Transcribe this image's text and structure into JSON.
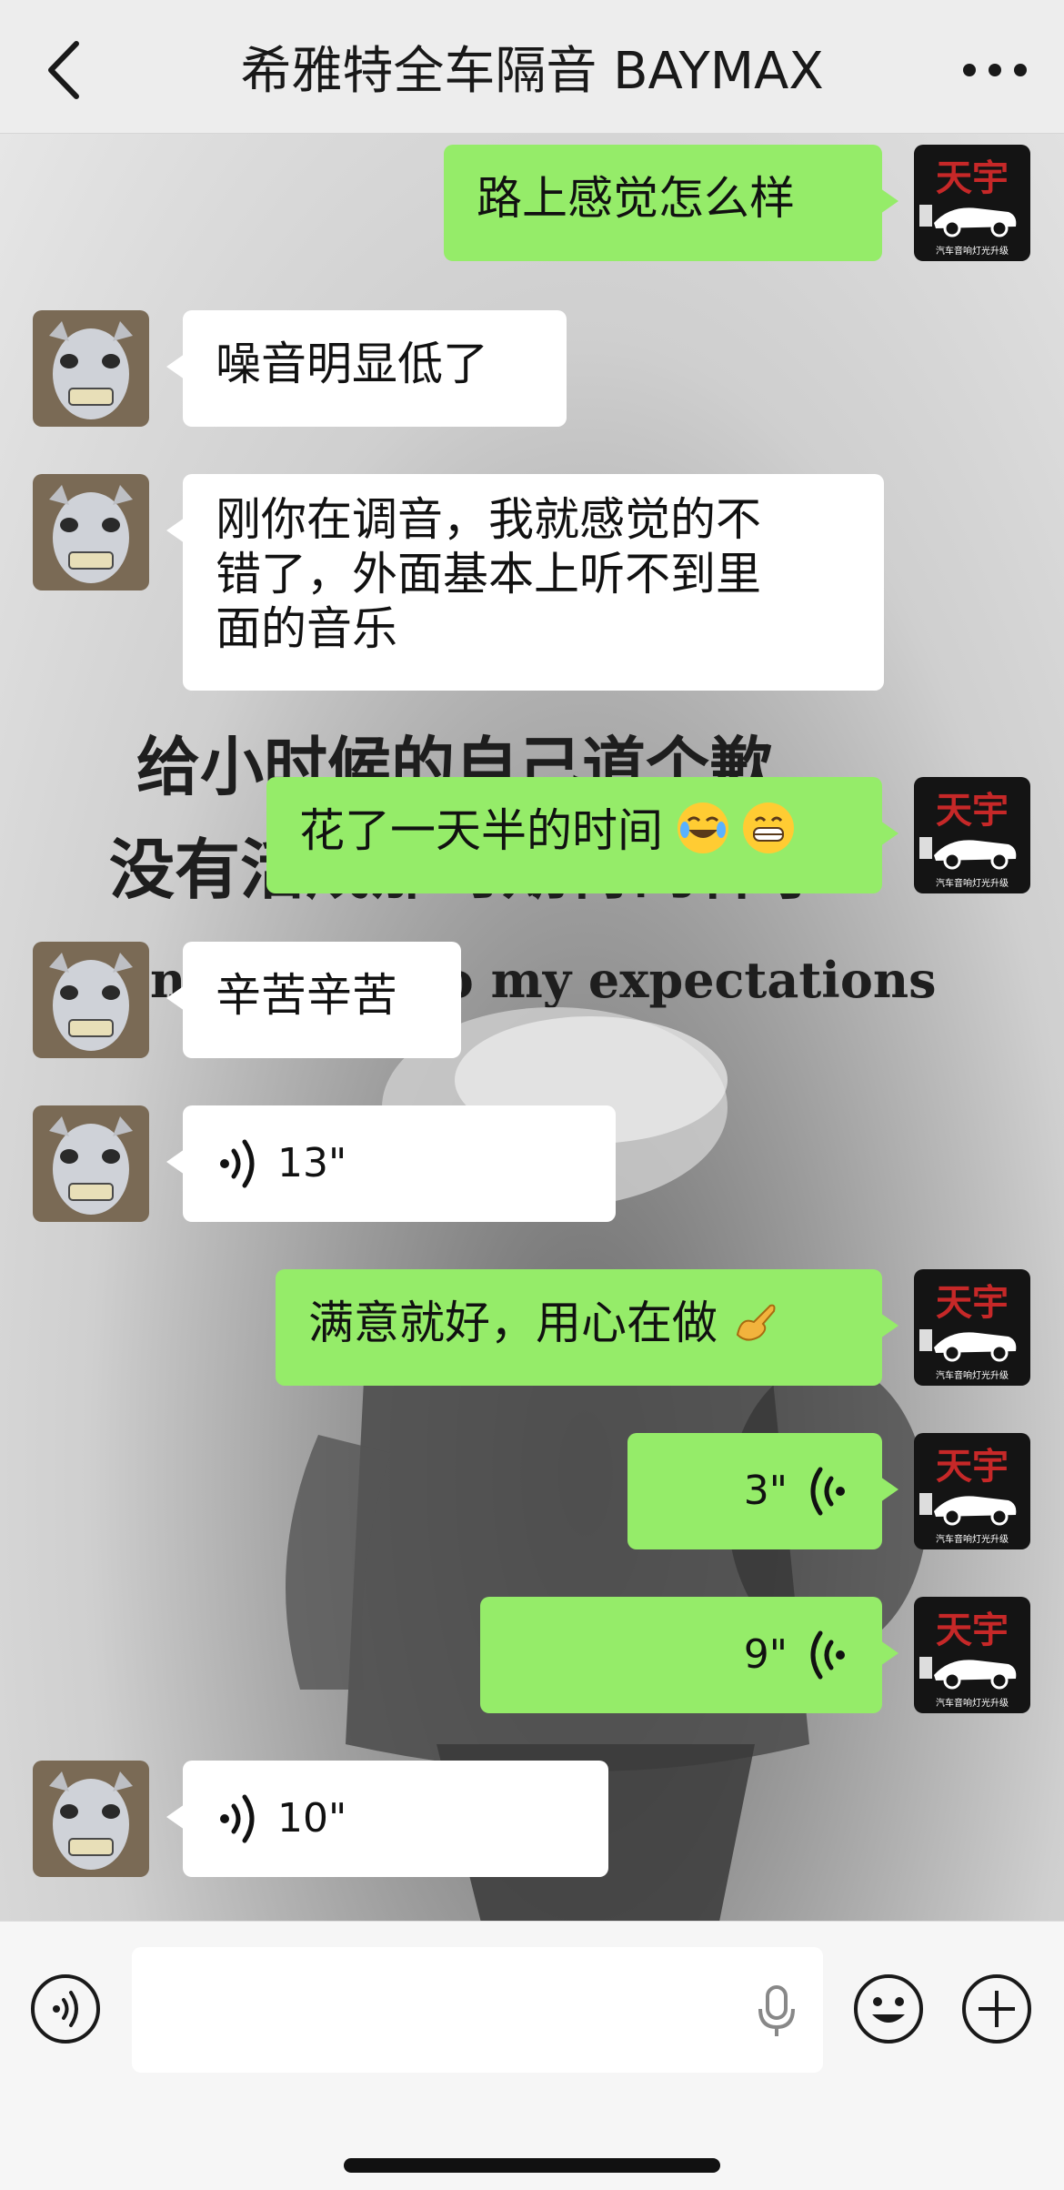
{
  "header": {
    "title": "希雅特全车隔音 BAYMAX"
  },
  "background_text": {
    "line1": "给小时候的自己道个歉",
    "line2": "没有活成那时期待的样子",
    "line3": "n... ve up to my expectations"
  },
  "me_avatar": {
    "big_text": "天宇",
    "small_text": "汽车音响灯光升级"
  },
  "messages": [
    {
      "sender": "me",
      "type": "text",
      "text": "路上感觉怎么样"
    },
    {
      "sender": "them",
      "type": "text",
      "text": "噪音明显低了"
    },
    {
      "sender": "them",
      "type": "text",
      "lines": [
        "刚你在调音，我就感觉的不",
        "错了，外面基本上听不到里",
        "面的音乐"
      ]
    },
    {
      "sender": "me",
      "type": "text",
      "text": "花了一天半的时间",
      "emojis": [
        "laughing-crying",
        "grinning"
      ]
    },
    {
      "sender": "them",
      "type": "text",
      "text": "辛苦辛苦"
    },
    {
      "sender": "them",
      "type": "voice",
      "duration": "13\""
    },
    {
      "sender": "me",
      "type": "text",
      "text": "满意就好，用心在做",
      "emojis": [
        "ok-hand"
      ]
    },
    {
      "sender": "me",
      "type": "voice",
      "duration": "3\""
    },
    {
      "sender": "me",
      "type": "voice",
      "duration": "9\""
    },
    {
      "sender": "them",
      "type": "voice",
      "duration": "10\""
    }
  ],
  "input": {
    "value": ""
  },
  "colors": {
    "me_bubble": "#95ec69",
    "them_bubble": "#ffffff",
    "avatar_red": "#c62828"
  }
}
